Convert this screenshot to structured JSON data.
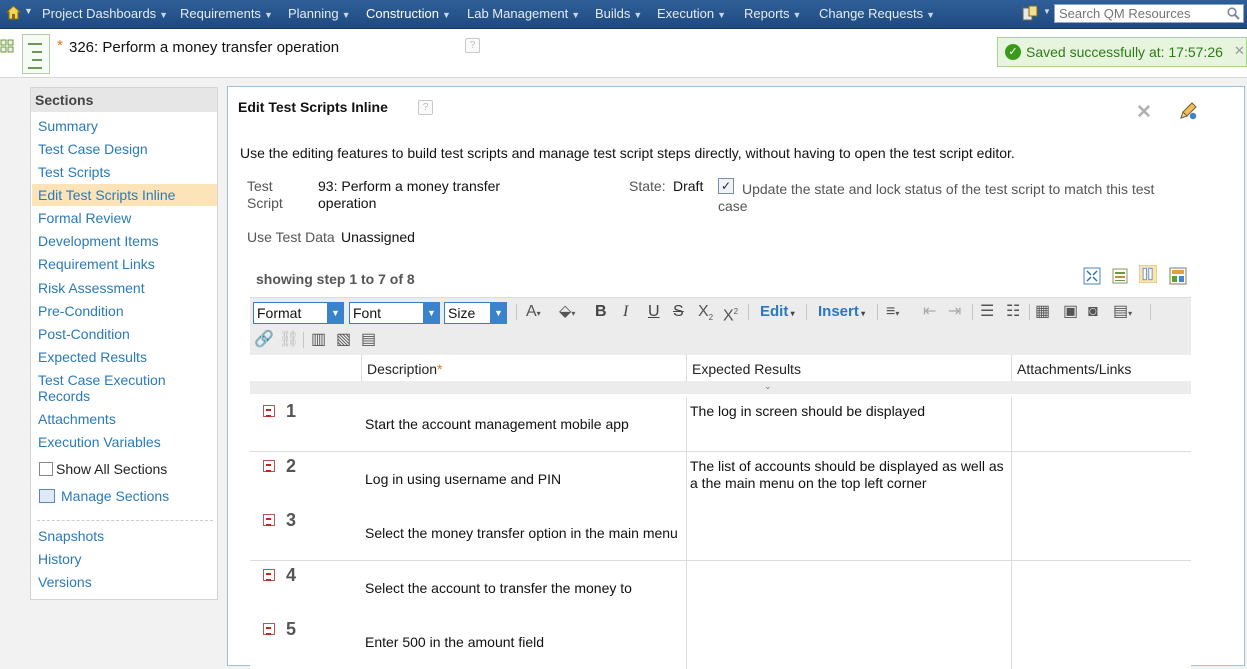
{
  "nav": {
    "items": [
      {
        "label": "Project Dashboards"
      },
      {
        "label": "Requirements"
      },
      {
        "label": "Planning"
      },
      {
        "label": "Construction"
      },
      {
        "label": "Lab Management"
      },
      {
        "label": "Builds"
      },
      {
        "label": "Execution"
      },
      {
        "label": "Reports"
      },
      {
        "label": "Change Requests"
      }
    ],
    "search_placeholder": "Search QM Resources",
    "colors": {
      "bar": "#1e4a80",
      "accent": "#2a7ab8"
    }
  },
  "header": {
    "dirty_marker": "*",
    "title": "326:  Perform a money transfer operation",
    "help": "?",
    "saved_message": "Saved successfully at: 17:57:26"
  },
  "sidebar": {
    "heading": "Sections",
    "items": [
      {
        "label": "Summary"
      },
      {
        "label": "Test Case Design"
      },
      {
        "label": "Test Scripts"
      },
      {
        "label": "Edit Test Scripts Inline"
      },
      {
        "label": "Formal Review"
      },
      {
        "label": "Development Items"
      },
      {
        "label": "Requirement Links"
      },
      {
        "label": "Risk Assessment"
      },
      {
        "label": "Pre-Condition"
      },
      {
        "label": "Post-Condition"
      },
      {
        "label": "Expected Results"
      },
      {
        "label": "Test Case Execution Records"
      },
      {
        "label": "Attachments"
      },
      {
        "label": "Execution Variables"
      }
    ],
    "active": "Edit Test Scripts Inline",
    "show_all_label": "Show All Sections",
    "manage_label": "Manage Sections",
    "footer_items": [
      {
        "label": "Snapshots"
      },
      {
        "label": "History"
      },
      {
        "label": "Versions"
      }
    ]
  },
  "main": {
    "title": "Edit Test Scripts Inline",
    "help": "?",
    "description": "Use the editing features to build test scripts and manage test script steps directly, without having to open the test script editor.",
    "test_script_label_1": "Test",
    "test_script_label_2": "Script",
    "test_script_value_1": "93: Perform a money transfer",
    "test_script_value_2": "operation",
    "state_label": "State:",
    "state_value": "Draft",
    "update_checked": true,
    "update_label_1": "Update the state and lock status of the test script to match this test",
    "update_label_2": "case",
    "test_data_label": "Use Test Data",
    "test_data_value": "Unassigned",
    "showing": "showing step 1 to 7 of 8",
    "toolbar": {
      "format": "Format",
      "font": "Font",
      "size": "Size",
      "edit": "Edit",
      "insert": "Insert"
    },
    "columns": {
      "description": "Description",
      "required_marker": "*",
      "expected": "Expected Results",
      "attachments": "Attachments/Links"
    },
    "steps": [
      {
        "num": "1",
        "description": "Start the account management mobile app",
        "expected": "The log in screen should be displayed"
      },
      {
        "num": "2",
        "description": "Log in using username and PIN",
        "expected": "The list of accounts should be displayed as well as a the main menu on the top left corner"
      },
      {
        "num": "3",
        "description": "Select the money transfer option in the main menu",
        "expected": ""
      },
      {
        "num": "4",
        "description": "Select the account to transfer the money to",
        "expected": ""
      },
      {
        "num": "5",
        "description": "Enter 500 in the amount field",
        "expected": ""
      }
    ]
  }
}
